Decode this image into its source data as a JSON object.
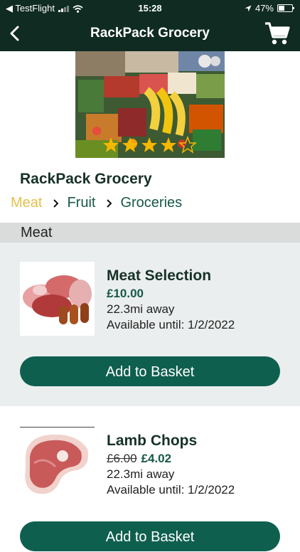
{
  "status_bar": {
    "back_app": "◀ TestFlight",
    "time": "15:28",
    "battery": "47%",
    "battery_level": 0.47
  },
  "nav": {
    "title": "RackPack Grocery",
    "back_icon": "chevron-left-icon",
    "cart_icon": "shopping-cart-icon"
  },
  "store": {
    "name": "RackPack Grocery",
    "rating_stars": 4
  },
  "breadcrumb": {
    "items": [
      "Meat",
      "Fruit",
      "Groceries"
    ],
    "active_index": 0
  },
  "section": {
    "title": "Meat"
  },
  "products": [
    {
      "name": "Meat Selection",
      "price": "£10.00",
      "old_price": "",
      "distance": "22.3mi away",
      "available": "Available until: 1/2/2022",
      "button": "Add to Basket"
    },
    {
      "name": "Lamb Chops",
      "price": "£4.02",
      "old_price": "£6.00",
      "distance": "22.3mi away",
      "available": "Available until: 1/2/2022",
      "button": "Add to Basket"
    }
  ],
  "colors": {
    "header_bg": "#0f2b22",
    "accent": "#0f5f4f",
    "active_crumb": "#e6c04d",
    "price": "#17594a"
  }
}
